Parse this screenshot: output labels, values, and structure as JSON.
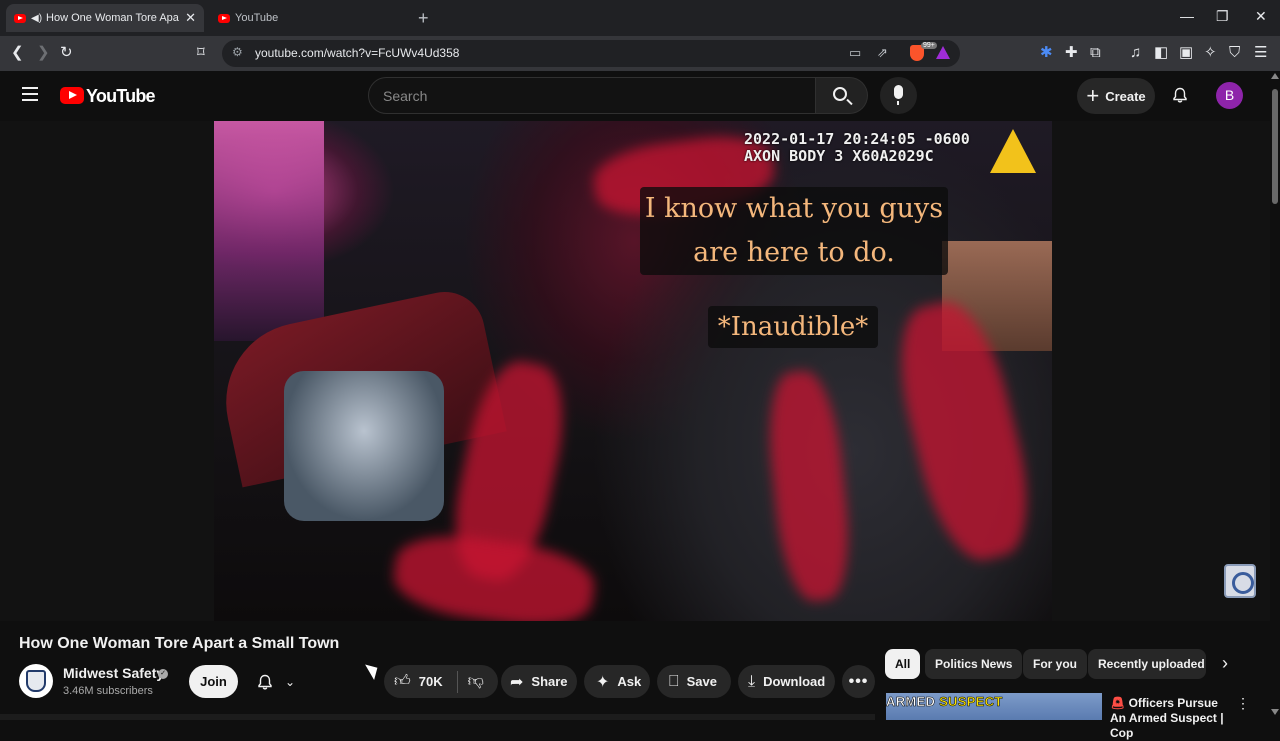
{
  "browser": {
    "tabs": [
      {
        "title": "How One Woman Tore Apart",
        "active": true
      },
      {
        "title": "YouTube",
        "active": false
      }
    ],
    "url": "youtube.com/watch?v=FcUWv4Ud358",
    "brave_badge": "99+"
  },
  "masthead": {
    "logo_text": "YouTube",
    "search_placeholder": "Search",
    "create_label": "Create",
    "avatar_letter": "B"
  },
  "video": {
    "overlay_timestamp": "2022-01-17 20:24:05 -0600",
    "overlay_device": "AXON BODY 3 X60A2029C",
    "caption_line1": "I know what you guys",
    "caption_line2": "are here to do.",
    "caption_inaudible": "*Inaudible*",
    "title": "How One Woman Tore Apart a Small Town"
  },
  "channel": {
    "name": "Midwest Safety",
    "subscribers": "3.46M subscribers",
    "join_label": "Join"
  },
  "actions": {
    "likes": "70K",
    "share": "Share",
    "ask": "Ask",
    "save": "Save",
    "download": "Download"
  },
  "chips": [
    "All",
    "Politics News",
    "For you",
    "Recently uploaded"
  ],
  "recommendation": {
    "thumb_text_a": "ARMED",
    "thumb_text_b": " SUSPECT",
    "title": "Officers Pursue An Armed Suspect | Cop"
  },
  "colors": {
    "youtube_red": "#ff0000",
    "caption_text": "#f4b77c",
    "avatar_bg": "#8e24aa"
  }
}
